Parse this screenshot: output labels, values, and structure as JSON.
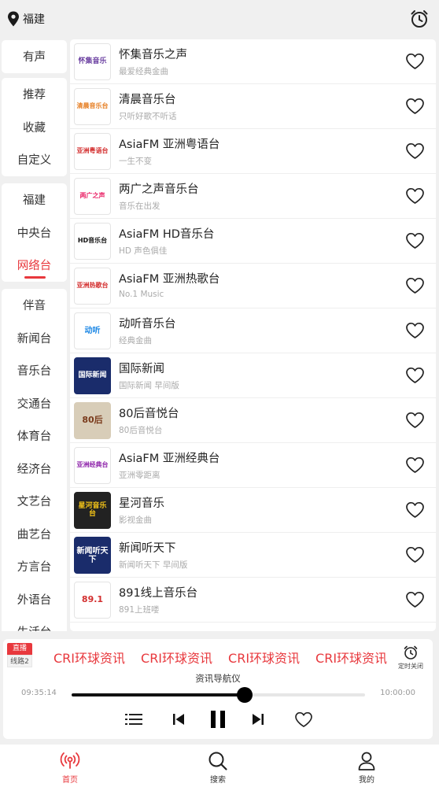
{
  "header": {
    "location": "福建",
    "location_icon": "location-pin-icon",
    "alarm_icon": "alarm-clock-icon"
  },
  "sidebar": {
    "group1": [
      "有声"
    ],
    "group2": [
      "推荐",
      "收藏",
      "自定义"
    ],
    "group3": [
      "福建",
      "中央台",
      "网络台"
    ],
    "group4": [
      "伴音",
      "新闻台",
      "音乐台",
      "交通台",
      "体育台",
      "经济台",
      "文艺台",
      "曲艺台",
      "方言台",
      "外语台",
      "生活台"
    ],
    "active": "网络台"
  },
  "stations": [
    {
      "title": "怀集音乐之声",
      "subtitle": "最爱经典金曲",
      "logo": "怀集音乐"
    },
    {
      "title": "清晨音乐台",
      "subtitle": "只听好歌不听话",
      "logo": "清晨音乐台"
    },
    {
      "title": "AsiaFM 亚洲粤语台",
      "subtitle": "一生不变",
      "logo": "亚洲粤语台"
    },
    {
      "title": "两广之声音乐台",
      "subtitle": "音乐在出发",
      "logo": "两广之声"
    },
    {
      "title": "AsiaFM HD音乐台",
      "subtitle": "HD 声色俱佳",
      "logo": "HD音乐台"
    },
    {
      "title": "AsiaFM 亚洲热歌台",
      "subtitle": "No.1 Music",
      "logo": "亚洲热歌台"
    },
    {
      "title": "动听音乐台",
      "subtitle": "经典金曲",
      "logo": "动听"
    },
    {
      "title": "国际新闻",
      "subtitle": "国际新闻 早间版",
      "logo": "国际新闻"
    },
    {
      "title": "80后音悦台",
      "subtitle": "80后音悦台",
      "logo": "80后"
    },
    {
      "title": "AsiaFM 亚洲经典台",
      "subtitle": "亚洲零距离",
      "logo": "亚洲经典台"
    },
    {
      "title": "星河音乐",
      "subtitle": "影视金曲",
      "logo": "星河音乐台"
    },
    {
      "title": "新闻听天下",
      "subtitle": "新闻听天下 早间版",
      "logo": "新闻听天下"
    },
    {
      "title": "891线上音乐台",
      "subtitle": "891上班喽",
      "logo": "89.1"
    }
  ],
  "player": {
    "live_badge": "直播",
    "line_badge": "线路2",
    "now_playing": "CRI环球资讯",
    "timer_label": "定时关闭",
    "program": "资讯导航仪",
    "time_current": "09:35:14",
    "time_end": "10:00:00",
    "progress": 0.59
  },
  "nav": [
    {
      "label": "首页",
      "icon": "radio-icon"
    },
    {
      "label": "搜索",
      "icon": "search-icon"
    },
    {
      "label": "我的",
      "icon": "user-icon"
    }
  ],
  "colors": {
    "accent": "#e8383d",
    "background": "#f0f0f0"
  }
}
